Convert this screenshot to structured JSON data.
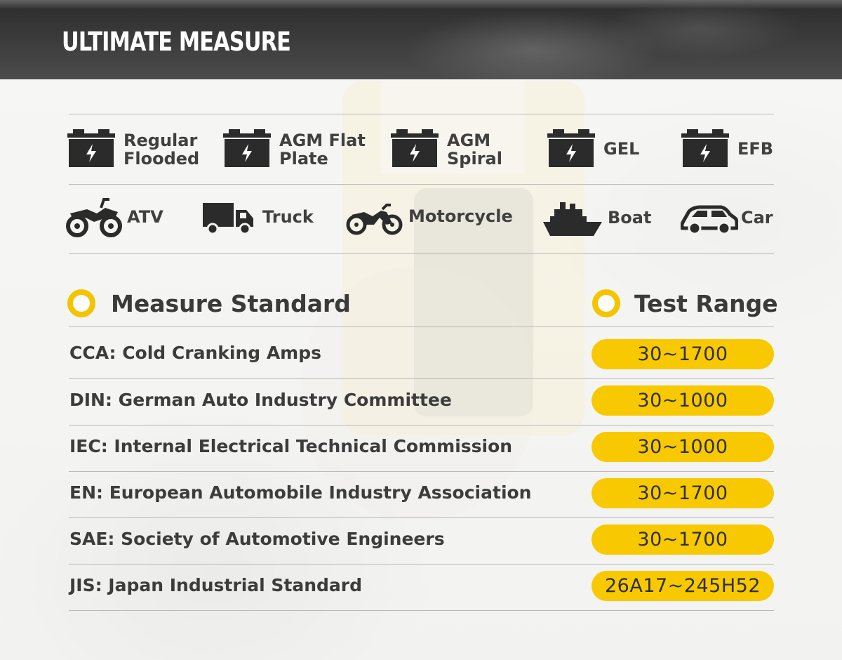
{
  "header": {
    "title": "ULTIMATE MEASURE"
  },
  "battery_types": [
    {
      "label": "Regular\nFlooded",
      "icon": "battery-icon"
    },
    {
      "label": "AGM Flat\nPlate",
      "icon": "battery-icon"
    },
    {
      "label": "AGM\nSpiral",
      "icon": "battery-icon"
    },
    {
      "label": "GEL",
      "icon": "battery-icon"
    },
    {
      "label": "EFB",
      "icon": "battery-icon"
    }
  ],
  "vehicles": [
    {
      "label": "ATV",
      "icon": "atv-icon"
    },
    {
      "label": "Truck",
      "icon": "truck-icon"
    },
    {
      "label": "Motorcycle",
      "icon": "motorcycle-icon"
    },
    {
      "label": "Boat",
      "icon": "boat-icon"
    },
    {
      "label": "Car",
      "icon": "car-icon"
    }
  ],
  "sections": {
    "standard_title": "Measure Standard",
    "range_title": "Test Range"
  },
  "standards": [
    {
      "label": "CCA: Cold Cranking Amps",
      "range": "30~1700"
    },
    {
      "label": "DIN: German Auto Industry Committee",
      "range": "30~1000"
    },
    {
      "label": "IEC: Internal Electrical Technical Commission",
      "range": "30~1000"
    },
    {
      "label": "EN: European Automobile Industry Association",
      "range": "30~1700"
    },
    {
      "label": "SAE: Society of Automotive Engineers",
      "range": "30~1700"
    },
    {
      "label": "JIS: Japan Industrial Standard",
      "range": "26A17~245H52"
    }
  ],
  "colors": {
    "accent": "#f8c900",
    "text": "#3c3c3c",
    "icon": "#2b2b2b"
  }
}
